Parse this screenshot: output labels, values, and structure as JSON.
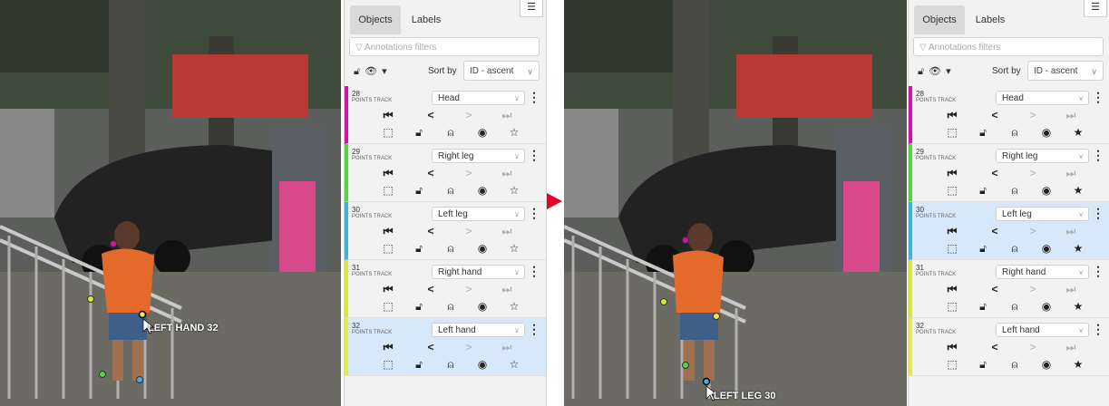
{
  "colors": {
    "head": "#d014a6",
    "right_leg": "#52d33f",
    "left_leg": "#3fb2da",
    "right_hand": "#d8e834",
    "left_hand": "#e8e84a",
    "selected_bg": "#d8e8fb",
    "arrow": "#e4002b"
  },
  "left_panel": {
    "tabs": [
      "Objects",
      "Labels"
    ],
    "filters_placeholder": "Annotations filters",
    "sort_label": "Sort by",
    "sort_value": "ID - ascent",
    "objects": [
      {
        "id": "28",
        "type": "POINTS TRACK",
        "label": "Head",
        "color": "#d014a6",
        "selected": false
      },
      {
        "id": "29",
        "type": "POINTS TRACK",
        "label": "Right leg",
        "color": "#52d33f",
        "selected": false
      },
      {
        "id": "30",
        "type": "POINTS TRACK",
        "label": "Left leg",
        "color": "#3fb2da",
        "selected": false
      },
      {
        "id": "31",
        "type": "POINTS TRACK",
        "label": "Right hand",
        "color": "#d8e834",
        "selected": false
      },
      {
        "id": "32",
        "type": "POINTS TRACK",
        "label": "Left hand",
        "color": "#e8e84a",
        "selected": true
      }
    ]
  },
  "right_panel": {
    "tabs": [
      "Objects",
      "Labels"
    ],
    "filters_placeholder": "Annotations filters",
    "sort_label": "Sort by",
    "sort_value": "ID - ascent",
    "objects": [
      {
        "id": "28",
        "type": "POINTS TRACK",
        "label": "Head",
        "color": "#d014a6",
        "selected": false
      },
      {
        "id": "29",
        "type": "POINTS TRACK",
        "label": "Right leg",
        "color": "#52d33f",
        "selected": false
      },
      {
        "id": "30",
        "type": "POINTS TRACK",
        "label": "Left leg",
        "color": "#3fb2da",
        "selected": true
      },
      {
        "id": "31",
        "type": "POINTS TRACK",
        "label": "Right hand",
        "color": "#d8e834",
        "selected": false
      },
      {
        "id": "32",
        "type": "POINTS TRACK",
        "label": "Left hand",
        "color": "#e8e84a",
        "selected": false
      }
    ]
  },
  "left_canvas": {
    "hover_label": "LEFT HAND 32"
  },
  "right_canvas": {
    "hover_label": "LEFT LEG 30"
  }
}
